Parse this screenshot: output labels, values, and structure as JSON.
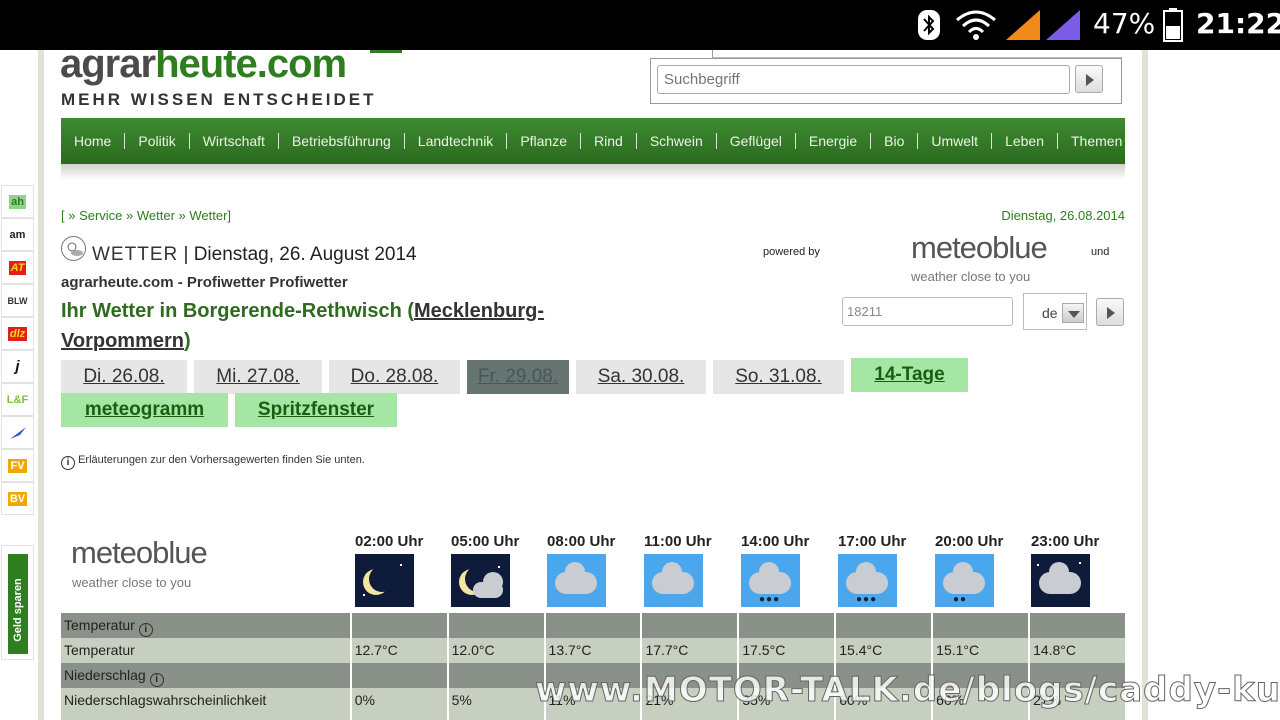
{
  "status_bar": {
    "battery": "47%",
    "time": "21:22"
  },
  "site": {
    "logo_agrar": "agrar",
    "logo_rest": "heute.com",
    "logo_sub": "MEHR WISSEN ENTSCHEIDET"
  },
  "search": {
    "placeholder": "Suchbegriff"
  },
  "nav": [
    "Home",
    "Politik",
    "Wirtschaft",
    "Betriebsführung",
    "Landtechnik",
    "Pflanze",
    "Rind",
    "Schwein",
    "Geflügel",
    "Energie",
    "Bio",
    "Umwelt",
    "Leben",
    "Themen"
  ],
  "sidebar": [
    "ah",
    "am",
    "AT",
    "BLW",
    "dlz",
    "j",
    "L&F",
    "",
    "FV",
    "BV"
  ],
  "geld_sparen": "Geld sparen",
  "breadcrumb": "[ » Service » Wetter » Wetter]",
  "date_top": "Dienstag, 26.08.2014",
  "wetter": {
    "label": "WETTER",
    "date": "| Dienstag, 26. August 2014"
  },
  "powered_by": "powered by",
  "und": "und",
  "meteoblue": {
    "name": "meteoblue",
    "tagline": "weather close to you"
  },
  "subtitle": "agrarheute.com - Profiwetter Profiwetter",
  "location": {
    "prefix": "Ihr Wetter in Borgerende-Rethwisch (",
    "region": "Mecklenburg-Vorpommern",
    "suffix": ")"
  },
  "zip": "18211",
  "lang": "de",
  "day_tabs": [
    "Di. 26.08.",
    "Mi. 27.08.",
    "Do. 28.08.",
    "Fr. 29.08.",
    "Sa. 30.08.",
    "So. 31.08."
  ],
  "extra_tabs": [
    "14-Tage",
    "meteogramm",
    "Spritzfenster"
  ],
  "info_text": "Erläuterungen zur den Vorhersagewerten finden Sie unten.",
  "hours": [
    "02:00 Uhr",
    "05:00 Uhr",
    "08:00 Uhr",
    "11:00 Uhr",
    "14:00 Uhr",
    "17:00 Uhr",
    "20:00 Uhr",
    "23:00 Uhr"
  ],
  "icons": [
    "night-moon",
    "night-moon-cloud",
    "day-cloud",
    "day-cloud",
    "day-cloud-rain",
    "day-cloud-rain",
    "day-cloud-rain",
    "night-cloud"
  ],
  "table": {
    "section_temp": "Temperatur",
    "row_temp_label": "Temperatur",
    "temps": [
      "12.7°C",
      "12.0°C",
      "13.7°C",
      "17.7°C",
      "17.5°C",
      "15.4°C",
      "15.1°C",
      "14.8°C"
    ],
    "section_precip": "Niederschlag",
    "row_prob_label": "Niederschlagswahrscheinlichkeit",
    "probs": [
      "0%",
      "5%",
      "11%",
      "21%",
      "35%",
      "60%",
      "60%",
      "27%"
    ]
  },
  "watermark": "www.MOTOR-TALK.de/blogs/caddy-kutscher/"
}
